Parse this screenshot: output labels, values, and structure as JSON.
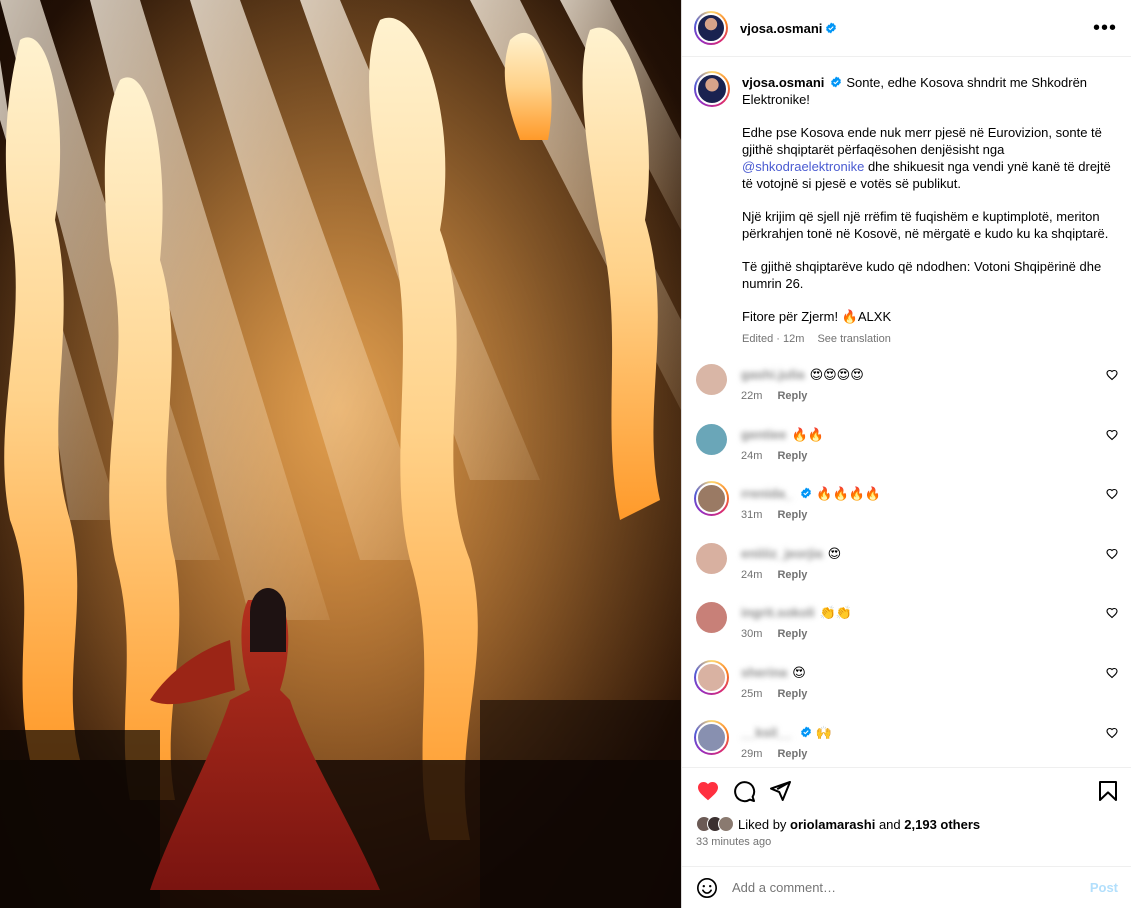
{
  "post": {
    "username": "vjosa.osmani",
    "caption_username": "vjosa.osmani",
    "caption_lines": [
      "Sonte, edhe Kosova shndrit me Shkodrën Elektronike!",
      "Edhe pse Kosova ende nuk merr pjesë në Eurovizion, sonte të gjithë shqiptarët përfaqësohen denjësisht nga",
      "@shkodraelektronike",
      "dhe shikuesit nga vendi ynë kanë të drejtë të votojnë si pjesë e votës së publikut.",
      "Një krijim që sjell një rrëfim të fuqishëm e kuptimplotë, meriton përkrahjen tonë në Kosovë, në mërgatë e kudo ku ka shqiptarë.",
      "Të gjithë shqiptarëve kudo që ndodhen: Votoni Shqipërinë dhe numrin 26.",
      "Fitore për Zjerm! 🔥ALXK"
    ],
    "edited": "Edited · 12m",
    "see_translation": "See translation"
  },
  "comments": [
    {
      "name": "gashi.julia",
      "text": "😍😍😍😍",
      "time": "22m",
      "reply": "Reply",
      "avatar": "#d9b6a6",
      "ring": false,
      "verified": false
    },
    {
      "name": "gentiee",
      "text": "🔥🔥",
      "time": "24m",
      "reply": "Reply",
      "avatar": "#6aa6b8",
      "ring": false,
      "verified": false
    },
    {
      "name": "rrenida_",
      "text": "🔥🔥🔥🔥",
      "time": "31m",
      "reply": "Reply",
      "avatar": "#9a7a64",
      "ring": true,
      "verified": true
    },
    {
      "name": "eniiiiz_jeorjia",
      "text": "😍",
      "time": "24m",
      "reply": "Reply",
      "avatar": "#d8b0a0",
      "ring": false,
      "verified": false
    },
    {
      "name": "ingrit.sokoli",
      "text": "👏👏",
      "time": "30m",
      "reply": "Reply",
      "avatar": "#c88078",
      "ring": false,
      "verified": false
    },
    {
      "name": "sherina",
      "text": "😍",
      "time": "25m",
      "reply": "Reply",
      "avatar": "#d9b2a2",
      "ring": true,
      "verified": false
    },
    {
      "name": "__ksil__",
      "text": "🙌",
      "time": "29m",
      "reply": "Reply",
      "avatar": "#8890b0",
      "ring": true,
      "verified": true
    }
  ],
  "likes": {
    "prefix": "Liked by",
    "user": "oriolamarashi",
    "and": "and",
    "count": "2,193 others",
    "time_ago": "33 minutes ago"
  },
  "add_comment": {
    "placeholder": "Add a comment…",
    "post_label": "Post"
  },
  "icons": {
    "like": "heart-filled-icon",
    "comment": "comment-icon",
    "share": "share-icon",
    "save": "bookmark-icon",
    "emoji": "emoji-icon",
    "more": "more-icon"
  },
  "colors": {
    "heart": "#ff3040",
    "link": "#4a5bd1",
    "muted": "#737373",
    "verified": "#0095f6"
  }
}
